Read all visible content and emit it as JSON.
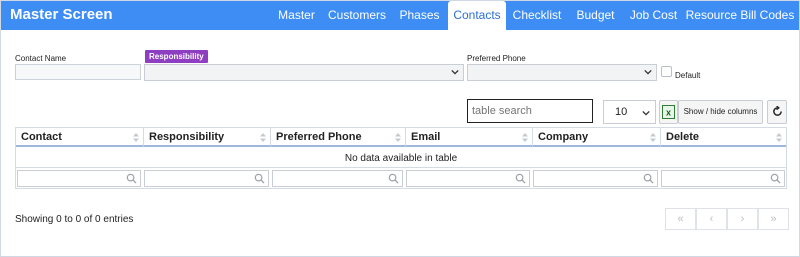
{
  "header": {
    "title": "Master Screen",
    "tabs": [
      {
        "label": "Master"
      },
      {
        "label": "Customers"
      },
      {
        "label": "Phases"
      },
      {
        "label": "Contacts",
        "active": true
      },
      {
        "label": "Checklist"
      },
      {
        "label": "Budget"
      },
      {
        "label": "Job Cost"
      },
      {
        "label": "Resource Bill Codes"
      }
    ],
    "accent_color": "#3d8df5"
  },
  "form": {
    "contact_name_label": "Contact Name",
    "contact_name_value": "",
    "responsibility_label": "Responsibility",
    "responsibility_value": "",
    "preferred_phone_label": "Preferred Phone",
    "preferred_phone_value": "",
    "default_label": "Default",
    "default_checked": false,
    "badge_color": "#8e3ec0"
  },
  "toolbar": {
    "search_placeholder": "table search",
    "page_length": "10",
    "excel_icon": "excel-icon",
    "columns_button": "Show / hide columns",
    "reset_icon": "reset-icon"
  },
  "table": {
    "columns": [
      "Contact",
      "Responsibility",
      "Preferred Phone",
      "Email",
      "Company",
      "Delete"
    ],
    "empty_message": "No data available in table",
    "header_rule_color": "#9fb8d9"
  },
  "footer": {
    "info": "Showing 0 to 0 of 0 entries",
    "pager": {
      "first": "«",
      "prev": "‹",
      "next": "›",
      "last": "»"
    }
  }
}
